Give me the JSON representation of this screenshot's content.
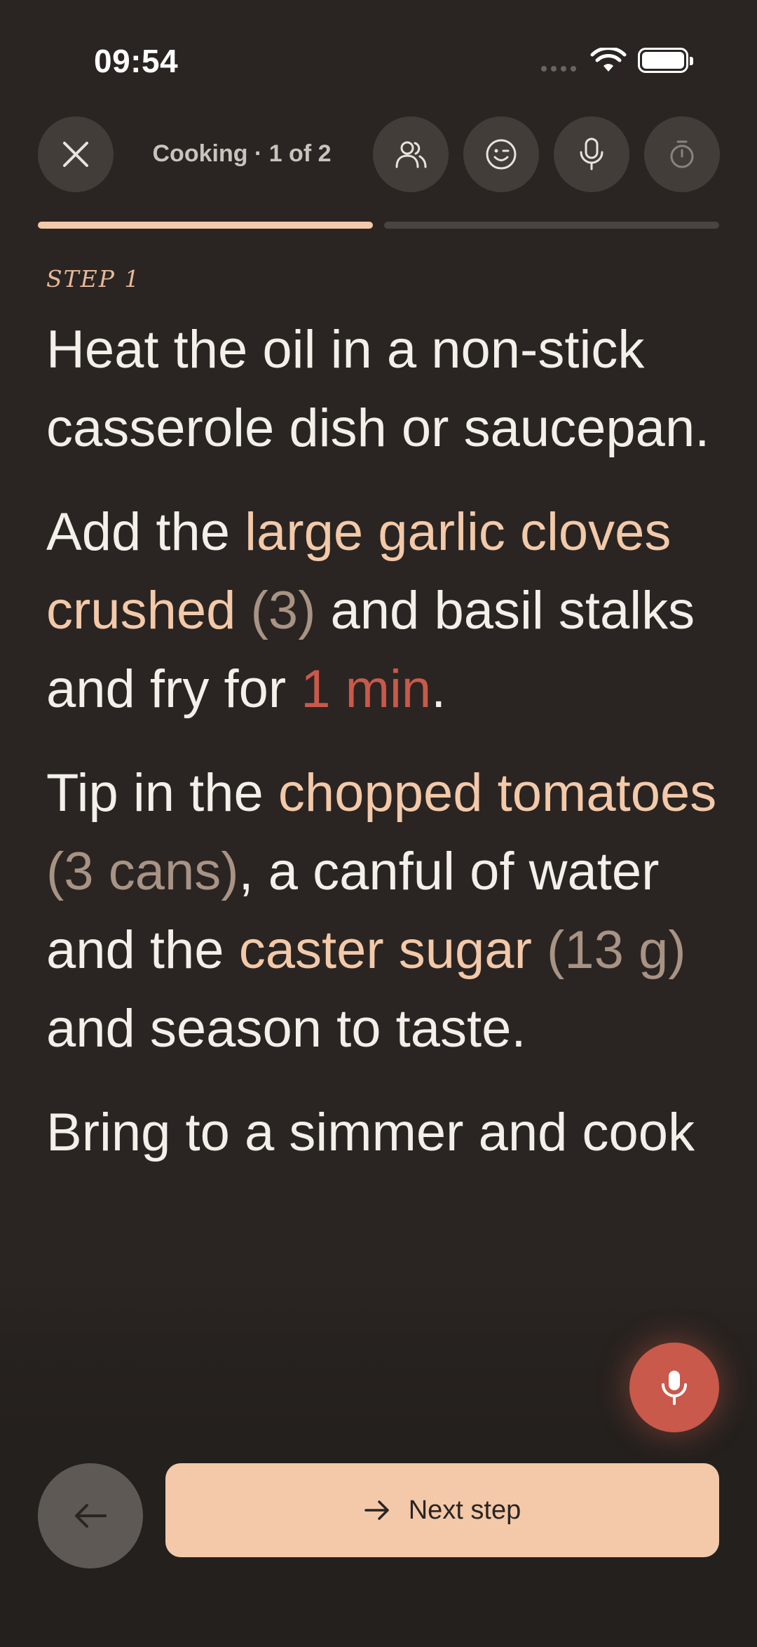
{
  "status": {
    "time": "09:54"
  },
  "toolbar": {
    "title": "Cooking · 1 of 2"
  },
  "progress": {
    "current_step": 1,
    "total_steps": 2
  },
  "step": {
    "label": "STEP 1",
    "paragraphs": [
      {
        "text": "Heat the oil in a non-stick casserole dish or saucepan."
      },
      {
        "pre": "Add the ",
        "ingredient": "large garlic cloves crushed",
        "quantity": "(3)",
        "mid": " and basil stalks and fry for ",
        "time": "1 min",
        "post": "."
      },
      {
        "pre": "Tip in the ",
        "ingredient1": "chopped tomatoes",
        "quantity1": "(3 cans)",
        "mid": ", a canful of water and the ",
        "ingredient2": "caster sugar",
        "quantity2": "(13 g)",
        "post": " and season to taste."
      },
      {
        "text": "Bring to a simmer and cook"
      }
    ]
  },
  "buttons": {
    "next_label": "Next step"
  },
  "icons": {
    "close": "close-icon",
    "servings": "people-icon",
    "feedback": "smiley-icon",
    "voice": "microphone-icon",
    "timer": "stopwatch-icon",
    "back": "arrow-left-icon",
    "next": "arrow-right-icon"
  },
  "colors": {
    "background": "#2a2522",
    "accent": "#f3c9a9",
    "time_highlight": "#c9594a",
    "quantity": "#a89384"
  }
}
